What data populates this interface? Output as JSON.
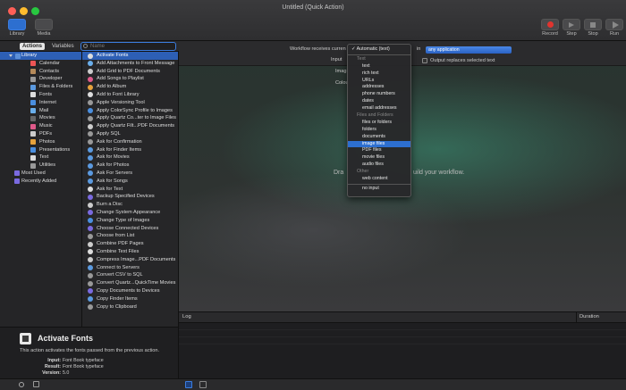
{
  "window": {
    "title": "Untitled (Quick Action)"
  },
  "toolbar": {
    "library": "Library",
    "media": "Media",
    "record": "Record",
    "step": "Step",
    "stop": "Stop",
    "run": "Run"
  },
  "left_tabs": {
    "actions": "Actions",
    "variables": "Variables",
    "search_placeholder": "Name"
  },
  "categories": [
    {
      "label": "Library",
      "level": "lib",
      "color": "#5b8fd8"
    },
    {
      "label": "Calendar",
      "level": "sub",
      "color": "#e55"
    },
    {
      "label": "Contacts",
      "level": "sub",
      "color": "#b58a5a"
    },
    {
      "label": "Developer",
      "level": "sub",
      "color": "#999"
    },
    {
      "label": "Files & Folders",
      "level": "sub",
      "color": "#5b9ae0"
    },
    {
      "label": "Fonts",
      "level": "sub",
      "color": "#ddd"
    },
    {
      "label": "Internet",
      "level": "sub",
      "color": "#4a8fe0"
    },
    {
      "label": "Mail",
      "level": "sub",
      "color": "#6aaeea"
    },
    {
      "label": "Movies",
      "level": "sub",
      "color": "#666"
    },
    {
      "label": "Music",
      "level": "sub",
      "color": "#e05a8a"
    },
    {
      "label": "PDFs",
      "level": "sub",
      "color": "#ccc"
    },
    {
      "label": "Photos",
      "level": "sub",
      "color": "#e6a23c"
    },
    {
      "label": "Presentations",
      "level": "sub",
      "color": "#4a8fe0"
    },
    {
      "label": "Text",
      "level": "sub",
      "color": "#ddd"
    },
    {
      "label": "Utilities",
      "level": "sub",
      "color": "#999"
    },
    {
      "label": "Most Used",
      "level": "extra",
      "color": "#7a6ae0"
    },
    {
      "label": "Recently Added",
      "level": "extra",
      "color": "#7a6ae0"
    }
  ],
  "actions": [
    {
      "label": "Activate Fonts",
      "color": "#ddd"
    },
    {
      "label": "Add Attachments to Front Message",
      "color": "#6aaeea"
    },
    {
      "label": "Add Grid to PDF Documents",
      "color": "#ccc"
    },
    {
      "label": "Add Songs to Playlist",
      "color": "#e05a8a"
    },
    {
      "label": "Add to Album",
      "color": "#e6a23c"
    },
    {
      "label": "Add to Font Library",
      "color": "#ddd"
    },
    {
      "label": "Apple Versioning Tool",
      "color": "#999"
    },
    {
      "label": "Apply ColorSync Profile to Images",
      "color": "#4a8fe0"
    },
    {
      "label": "Apply Quartz Co...ter to Image Files",
      "color": "#999"
    },
    {
      "label": "Apply Quartz Filt...PDF Documents",
      "color": "#ccc"
    },
    {
      "label": "Apply SQL",
      "color": "#999"
    },
    {
      "label": "Ask for Confirmation",
      "color": "#999"
    },
    {
      "label": "Ask for Finder Items",
      "color": "#5b9ae0"
    },
    {
      "label": "Ask for Movies",
      "color": "#5b9ae0"
    },
    {
      "label": "Ask for Photos",
      "color": "#5b9ae0"
    },
    {
      "label": "Ask For Servers",
      "color": "#5b9ae0"
    },
    {
      "label": "Ask for Songs",
      "color": "#5b9ae0"
    },
    {
      "label": "Ask for Text",
      "color": "#ddd"
    },
    {
      "label": "Backup Specified Devices",
      "color": "#7a6ae0"
    },
    {
      "label": "Burn a Disc",
      "color": "#ccc"
    },
    {
      "label": "Change System Appearance",
      "color": "#7a6ae0"
    },
    {
      "label": "Change Type of Images",
      "color": "#4a8fe0"
    },
    {
      "label": "Choose Connected Devices",
      "color": "#7a6ae0"
    },
    {
      "label": "Choose from List",
      "color": "#999"
    },
    {
      "label": "Combine PDF Pages",
      "color": "#ccc"
    },
    {
      "label": "Combine Text Files",
      "color": "#ddd"
    },
    {
      "label": "Compress Image...PDF Documents",
      "color": "#ccc"
    },
    {
      "label": "Connect to Servers",
      "color": "#5b9ae0"
    },
    {
      "label": "Convert CSV to SQL",
      "color": "#999"
    },
    {
      "label": "Convert Quartz...QuickTime Movies",
      "color": "#999"
    },
    {
      "label": "Copy Documents to Devices",
      "color": "#7a6ae0"
    },
    {
      "label": "Copy Finder Items",
      "color": "#5b9ae0"
    },
    {
      "label": "Copy to Clipboard",
      "color": "#999"
    }
  ],
  "description": {
    "title": "Activate Fonts",
    "text": "This action activates the fonts passed from the previous action.",
    "input_key": "Input:",
    "input_val": "Font Book typeface",
    "result_key": "Result:",
    "result_val": "Font Book typeface",
    "version_key": "Version:",
    "version_val": "5.0"
  },
  "workflow": {
    "receives_label": "Workflow receives curren",
    "in_label": "in",
    "in_value": "any application",
    "input_label": "Input",
    "image_label": "Imag",
    "color_label": "Colou",
    "output_replaces": "Output replaces selected text",
    "drop_left": "Dra",
    "drop_right": "uild your workflow."
  },
  "menu": {
    "selected": "✓ Automatic (text)",
    "groups": [
      {
        "header": "Text",
        "items": [
          "text",
          "rich text",
          "URLs",
          "addresses",
          "phone numbers",
          "dates",
          "email addresses"
        ]
      },
      {
        "header": "Files and Folders",
        "items": [
          "files or folders",
          "folders",
          "documents",
          "image files",
          "PDF files",
          "movie files",
          "audio files"
        ]
      },
      {
        "header": "Other",
        "items": [
          "web content"
        ]
      }
    ],
    "highlighted": "image files",
    "last": "no input"
  },
  "log": {
    "col_log": "Log",
    "col_duration": "Duration"
  }
}
